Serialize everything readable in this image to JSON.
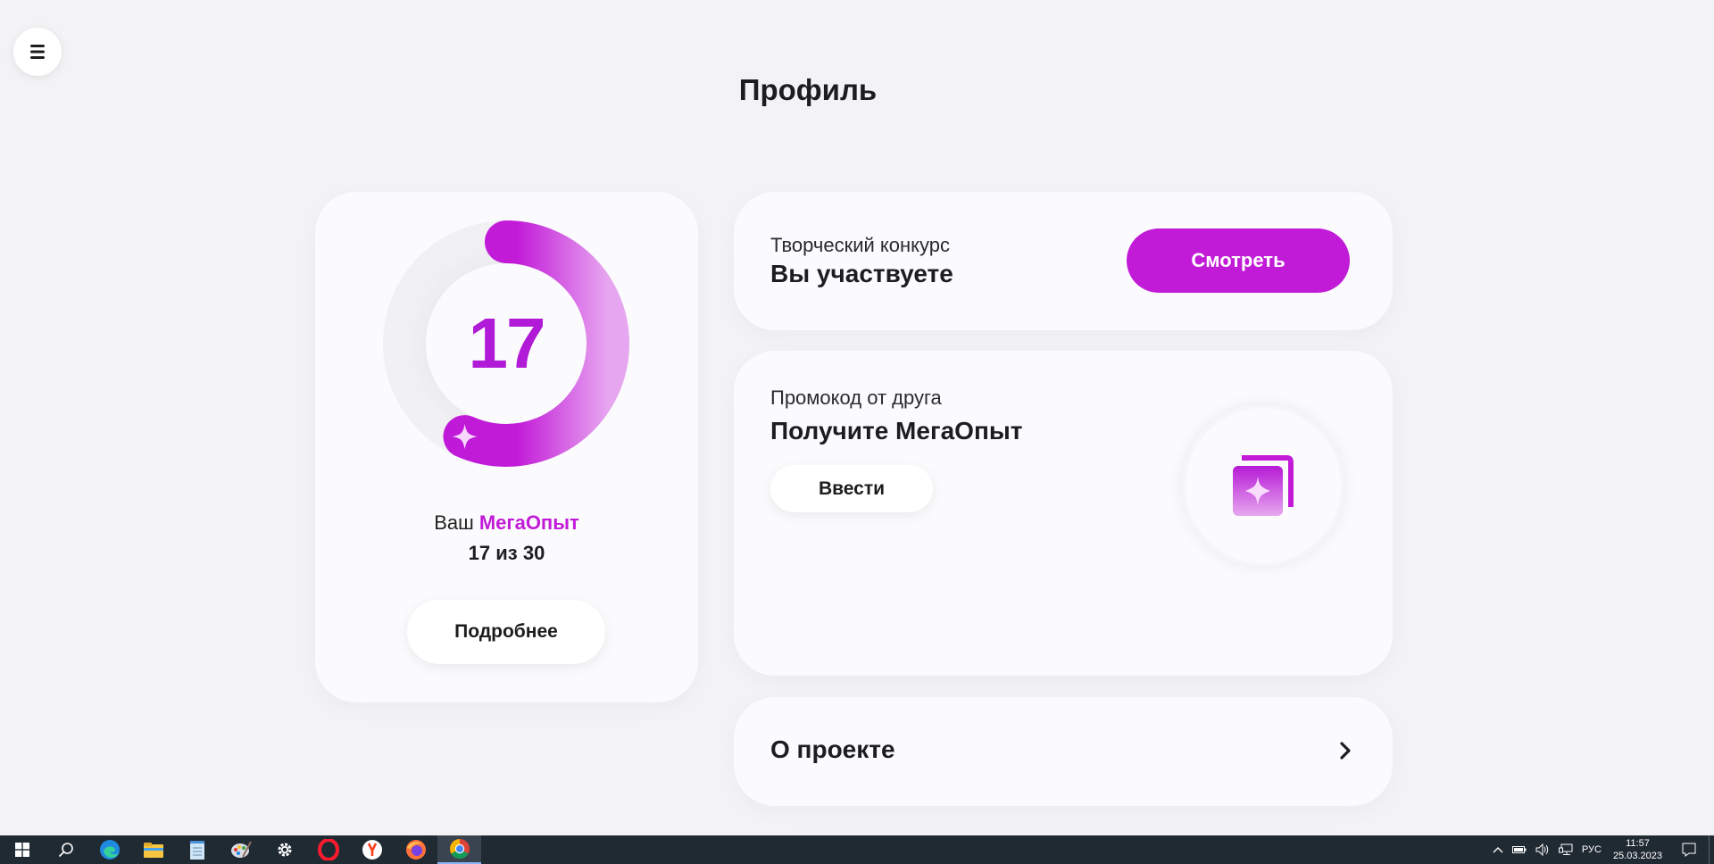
{
  "header": {
    "title": "Профиль"
  },
  "experience": {
    "value": "17",
    "max": 30,
    "progress": 17,
    "caption_prefix": "Ваш ",
    "caption_accent": "МегаОпыт",
    "count_text": "17 из 30",
    "more_button": "Подробнее"
  },
  "contest": {
    "subtitle": "Творческий конкурс",
    "status": "Вы участвуете",
    "button": "Смотреть"
  },
  "promo": {
    "subtitle": "Промокод от друга",
    "title": "Получите МегаОпыт",
    "button": "Ввести"
  },
  "about": {
    "title": "О проекте"
  },
  "colors": {
    "accent": "#c21bd8",
    "background": "#f3f3f6",
    "card": "#fbfbfd",
    "taskbar": "#202a33"
  },
  "taskbar": {
    "icons": [
      "windows-start-icon",
      "search-icon",
      "edge-icon",
      "file-explorer-icon",
      "notepad-icon",
      "paint-icon",
      "settings-gear-icon",
      "opera-icon",
      "yandex-browser-icon",
      "firefox-icon",
      "chrome-icon"
    ],
    "language": "РУС",
    "time": "11:57",
    "date": "25.03.2023"
  }
}
